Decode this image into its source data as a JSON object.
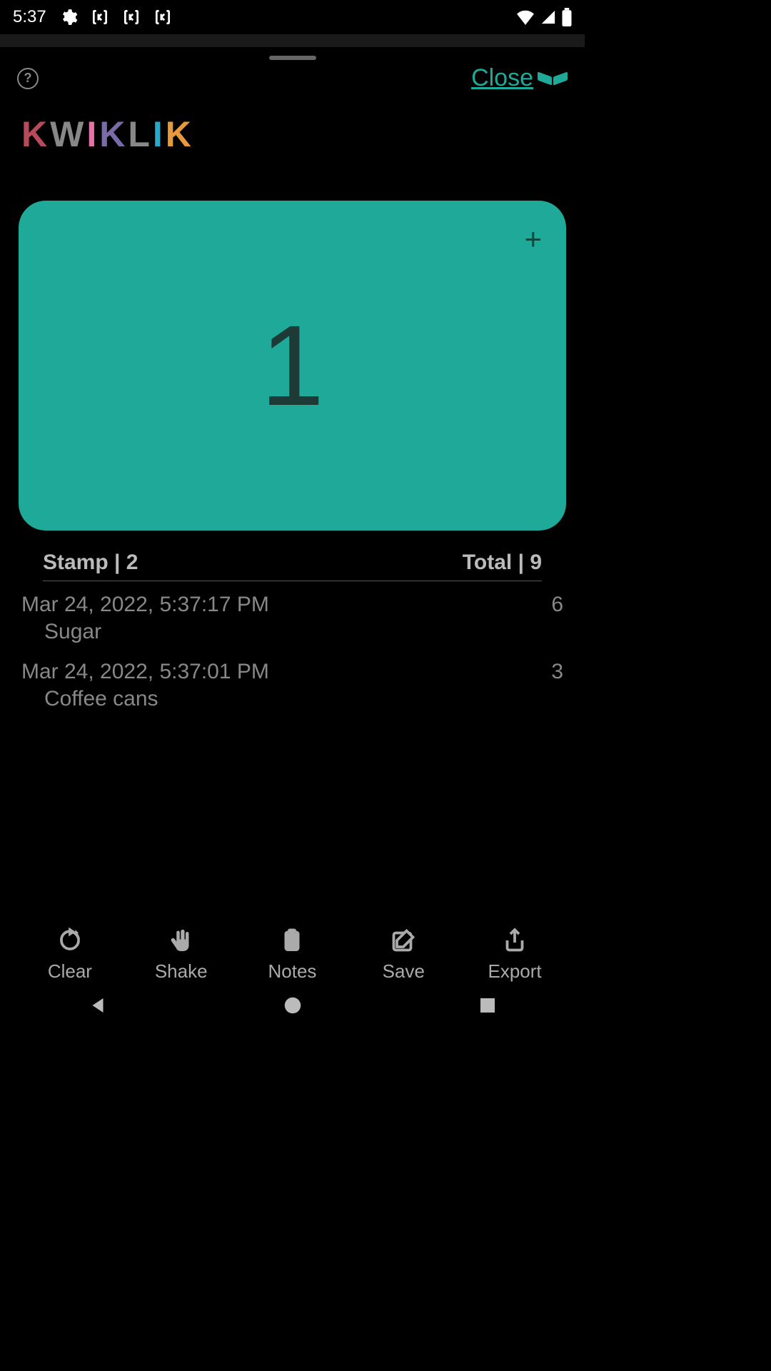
{
  "status": {
    "time": "5:37"
  },
  "header": {
    "close_label": "Close"
  },
  "logo": {
    "letters": [
      "K",
      "W",
      "I",
      "K",
      "L",
      "I",
      "K"
    ]
  },
  "counter": {
    "value": "1"
  },
  "summary": {
    "stamp_label": "Stamp",
    "stamp_value": "2",
    "total_label": "Total",
    "total_value": "9"
  },
  "entries": [
    {
      "timestamp": "Mar 24, 2022, 5:37:17 PM",
      "note": "Sugar",
      "count": "6"
    },
    {
      "timestamp": "Mar 24, 2022, 5:37:01 PM",
      "note": "Coffee cans",
      "count": "3"
    }
  ],
  "actions": {
    "clear": "Clear",
    "shake": "Shake",
    "notes": "Notes",
    "save": "Save",
    "export": "Export"
  },
  "colors": {
    "logo": [
      "#b84a5a",
      "#888",
      "#e86fa8",
      "#7a6aa8",
      "#888",
      "#2aa8c8",
      "#e89a3a"
    ]
  }
}
